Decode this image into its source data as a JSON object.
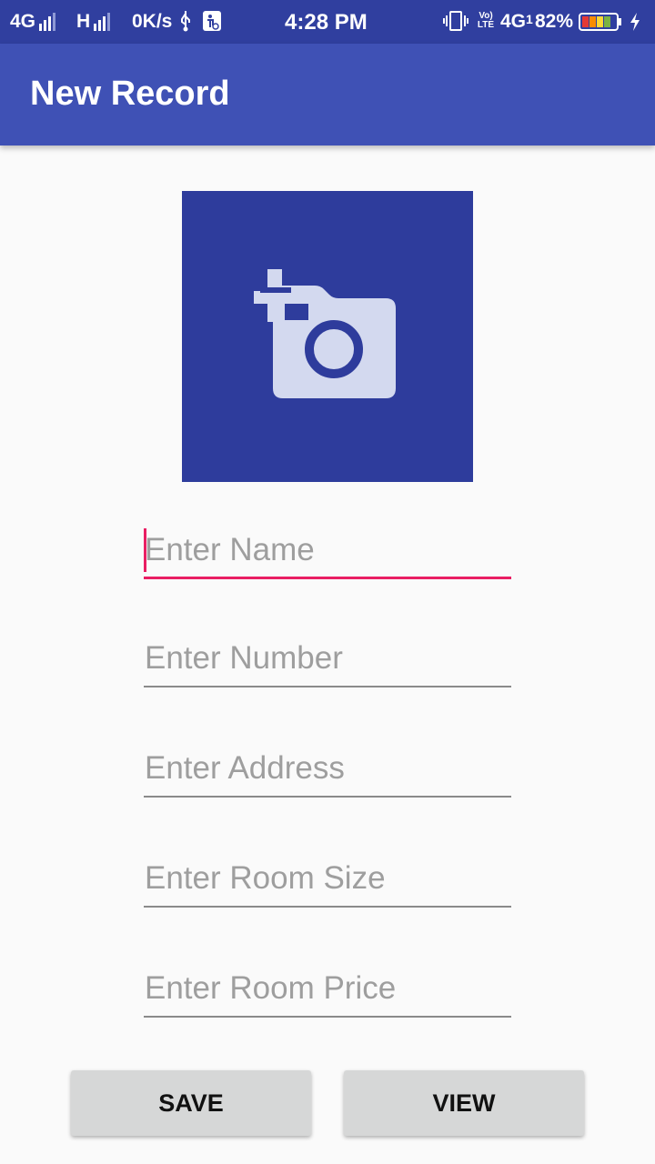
{
  "status_bar": {
    "network1": "4G",
    "network2": "H",
    "speed": "0K/s",
    "time": "4:28 PM",
    "volte": "Vo) LTE",
    "network3": "4G",
    "sim_index": "1",
    "battery": "82%",
    "icons": [
      "signal-icon",
      "usb-icon",
      "accessibility-icon",
      "vibrate-icon",
      "battery-icon",
      "charging-icon"
    ],
    "battery_level": 0.82
  },
  "app_bar": {
    "title": "New Record"
  },
  "photo": {
    "icon": "add-photo-icon",
    "background": "#2e3c9c",
    "icon_color": "#d3d9ef"
  },
  "form": {
    "name_placeholder": "Enter Name",
    "number_placeholder": "Enter Number",
    "address_placeholder": "Enter Address",
    "room_size_placeholder": "Enter Room Size",
    "room_price_placeholder": "Enter Room Price"
  },
  "buttons": {
    "save_label": "SAVE",
    "view_label": "VIEW"
  },
  "colors": {
    "primary": "#3f51b5",
    "primary_dark": "#303f9f",
    "accent": "#e91e63"
  }
}
